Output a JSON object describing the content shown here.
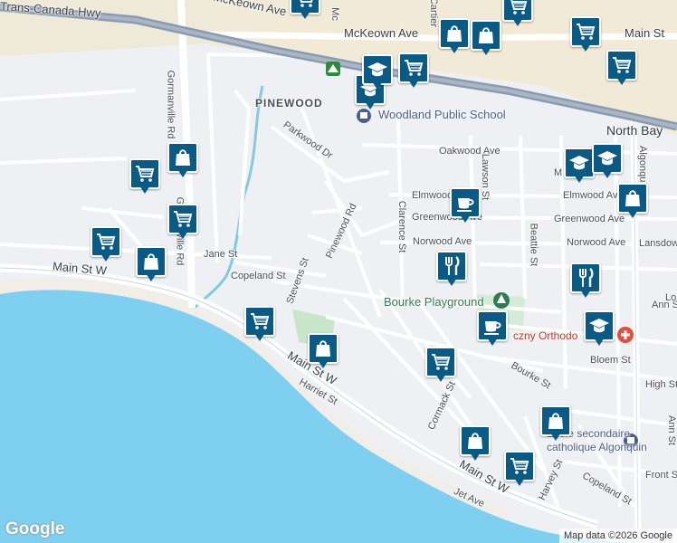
{
  "map": {
    "roads": {
      "highway": "Trans-Canada Hwy",
      "mckeown_left": "McKeown Ave",
      "mckeown_mid": "McKeown Ave",
      "main_st_top": "Main St",
      "main_st_w_left": "Main St W",
      "main_st_w_mid": "Main St W",
      "main_st_w_bottom": "Main St W",
      "gormanville_1": "Gormanville Rd",
      "gormanville_2": "Gormanville Rd",
      "parkwood": "Parkwood Dr",
      "pinewood": "Pinewood Rd",
      "stevens": "Stevens St",
      "copeland_left": "Copeland St",
      "copeland_right": "Copeland St",
      "jane": "Jane St",
      "oakwood": "Oakwood Ave",
      "elmwood_left": "Elmwood Ave",
      "elmwood_right": "Elmwood Ave",
      "greenwood_left": "Greenwood Ave",
      "greenwood_right": "Greenwood Ave",
      "norwood_left": "Norwood Ave",
      "norwood_right": "Norwood Ave",
      "lansdowne": "Lansdowne",
      "clarence": "Clarence St",
      "lawson": "Lawson St",
      "beattie": "Beattie St",
      "algonquin": "Algonquin",
      "ann_right": "Ann St",
      "ann_bottom": "Ann St",
      "bloem": "Bloem St",
      "bourke": "Bourke St",
      "cormack": "Cormack St",
      "harriet": "Harriet St",
      "jet": "Jet Ave",
      "harvey": "Harvey St",
      "front": "Front St",
      "high": "High St",
      "lo": "Lo",
      "cartier": "Cartier",
      "mc_top": "Mc",
      "m_left": "M",
      "ma_elm": "Ma"
    },
    "places": {
      "city": "North Bay",
      "neighborhood": "PINEWOOD",
      "school": "Woodland Public School",
      "park": "Bourke Playground",
      "church": "czny Orthodo",
      "ecole_line1": "École secondaire",
      "ecole_line2": "catholique Algonquin"
    },
    "footer": {
      "logo": "Google",
      "attribution": "Map data ©2026 Google"
    },
    "colors": {
      "pin": "#0a5a86",
      "water": "#7fcff0",
      "land": "#eef0f3",
      "highway": "#8a9bb0",
      "park": "#c8e6c9",
      "river": "#80cbe4"
    },
    "pins": [
      {
        "name": "shopping-cart-pin",
        "icon": "shopping-cart-icon"
      },
      {
        "name": "shopping-cart-pin",
        "icon": "shopping-cart-icon"
      },
      {
        "name": "shopping-bag-pin",
        "icon": "shopping-bag-icon"
      },
      {
        "name": "shopping-bag-pin",
        "icon": "shopping-bag-icon"
      },
      {
        "name": "shopping-cart-pin",
        "icon": "shopping-cart-icon"
      },
      {
        "name": "shopping-cart-pin",
        "icon": "shopping-cart-icon"
      },
      {
        "name": "shopping-cart-pin",
        "icon": "shopping-cart-icon"
      },
      {
        "name": "shopping-cart-pin",
        "icon": "shopping-cart-icon"
      },
      {
        "name": "shopping-bag-pin",
        "icon": "shopping-bag-icon"
      },
      {
        "name": "shopping-cart-pin",
        "icon": "shopping-cart-icon"
      },
      {
        "name": "shopping-bag-pin",
        "icon": "shopping-bag-icon"
      },
      {
        "name": "shopping-cart-pin",
        "icon": "shopping-cart-icon"
      },
      {
        "name": "school-pin",
        "icon": "graduation-cap-icon"
      },
      {
        "name": "school-pin",
        "icon": "graduation-cap-icon"
      },
      {
        "name": "school-pin",
        "icon": "graduation-cap-icon"
      },
      {
        "name": "school-pin",
        "icon": "graduation-cap-icon"
      },
      {
        "name": "school-pin",
        "icon": "graduation-cap-icon"
      },
      {
        "name": "cafe-pin",
        "icon": "coffee-cup-icon"
      },
      {
        "name": "cafe-pin",
        "icon": "coffee-cup-icon"
      },
      {
        "name": "shopping-bag-pin",
        "icon": "shopping-bag-icon"
      },
      {
        "name": "restaurant-pin",
        "icon": "fork-knife-icon"
      },
      {
        "name": "restaurant-pin",
        "icon": "fork-knife-icon"
      },
      {
        "name": "shopping-cart-pin",
        "icon": "shopping-cart-icon"
      },
      {
        "name": "shopping-bag-pin",
        "icon": "shopping-bag-icon"
      },
      {
        "name": "shopping-cart-pin",
        "icon": "shopping-cart-icon"
      },
      {
        "name": "shopping-bag-pin",
        "icon": "shopping-bag-icon"
      },
      {
        "name": "shopping-bag-pin",
        "icon": "shopping-bag-icon"
      },
      {
        "name": "shopping-cart-pin",
        "icon": "shopping-cart-icon"
      },
      {
        "name": "shopping-cart-pin",
        "icon": "shopping-cart-icon"
      }
    ]
  }
}
